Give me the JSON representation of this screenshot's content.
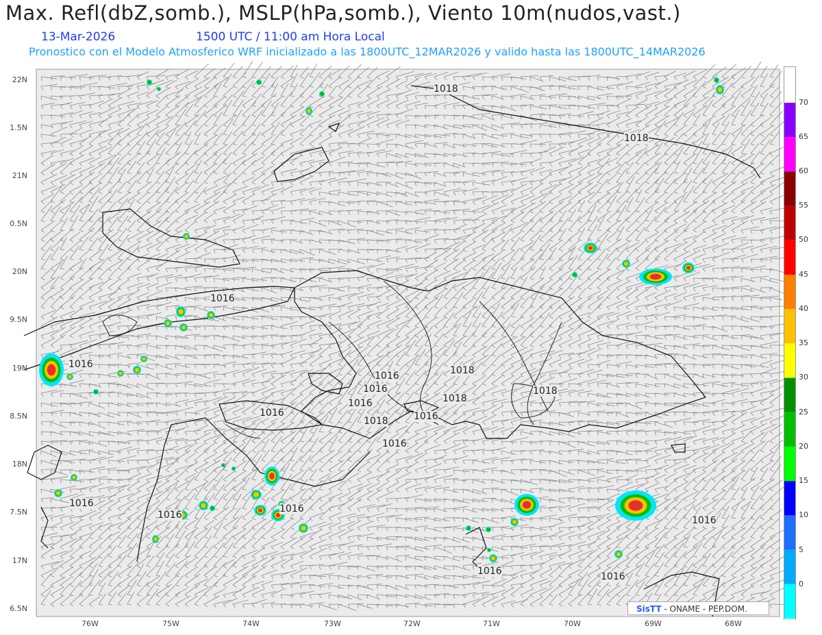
{
  "header": {
    "title": "Max. Refl(dbZ,somb.), MSLP(hPa,somb.), Viento 10m(nudos,vast.)",
    "date": "13-Mar-2026",
    "time": "1500 UTC / 11:00 am Hora Local",
    "forecast_note": "Pronostico con el Modelo Atmosferico WRF inicializado a las 1800UTC_12MAR2026 y valido hasta las  1800UTC_14MAR2026"
  },
  "axes": {
    "lat_labels": [
      "22N",
      "1.5N",
      "21N",
      "0.5N",
      "20N",
      "9.5N",
      "19N",
      "8.5N",
      "18N",
      "7.5N",
      "17N",
      "6.5N"
    ],
    "lon_labels": [
      "76W",
      "75W",
      "74W",
      "73W",
      "72W",
      "71W",
      "70W",
      "69W",
      "68W"
    ]
  },
  "isobars": [
    "1018",
    "1018",
    "1016",
    "1016",
    "1016",
    "1016",
    "1016",
    "1018",
    "1018",
    "1018",
    "1016",
    "1018",
    "1016",
    "1016",
    "1016",
    "1016",
    "1016",
    "1016",
    "1016",
    "1016"
  ],
  "colorbar": {
    "labels": [
      "70",
      "65",
      "60",
      "55",
      "50",
      "45",
      "40",
      "35",
      "30",
      "25",
      "20",
      "15",
      "10",
      "5",
      "0"
    ],
    "colors": [
      "#8a00ff",
      "#ff00ff",
      "#8b0000",
      "#c00000",
      "#ff0000",
      "#ff7f00",
      "#ffc000",
      "#ffff00",
      "#009000",
      "#00c000",
      "#00ff00",
      "#0000ff",
      "#1e6eff",
      "#00aaff",
      "#00ffff"
    ]
  },
  "credit": {
    "logo": "SisTT",
    "text": " - ONAME - PEP.DOM."
  }
}
